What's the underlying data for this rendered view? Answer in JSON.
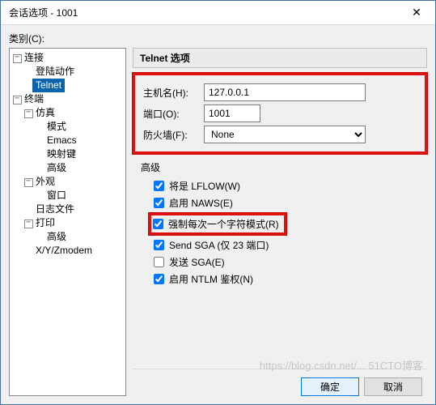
{
  "window": {
    "title": "会话选项 - 1001",
    "close_tooltip": "关闭"
  },
  "category_label": "类别(C):",
  "tree": {
    "n0": "连接",
    "n0_0": "登陆动作",
    "n0_1": "Telnet",
    "n1": "终端",
    "n1_0": "仿真",
    "n1_0_0": "模式",
    "n1_0_1": "Emacs",
    "n1_0_2": "映射键",
    "n1_0_3": "高级",
    "n1_1": "外观",
    "n1_1_0": "窗口",
    "n1_2": "日志文件",
    "n1_3": "打印",
    "n1_3_0": "高级",
    "n1_4": "X/Y/Zmodem"
  },
  "panel": {
    "header": "Telnet 选项",
    "host_label": "主机名(H):",
    "host_value": "127.0.0.1",
    "port_label": "端口(O):",
    "port_value": "1001",
    "firewall_label": "防火墙(F):",
    "firewall_value": "None",
    "adv_label": "高级",
    "chk_lflow": "将是 LFLOW(W)",
    "chk_naws": "启用 NAWS(E)",
    "chk_force": "强制每次一个字符模式(R)",
    "chk_sga": "Send SGA (仅 23 端口)",
    "chk_send_sga": "发送 SGA(E)",
    "chk_ntlm": "启用 NTLM 鉴权(N)"
  },
  "buttons": {
    "ok": "确定",
    "cancel": "取消"
  },
  "watermark": "https://blog.csdn.net/... 51CTO博客"
}
